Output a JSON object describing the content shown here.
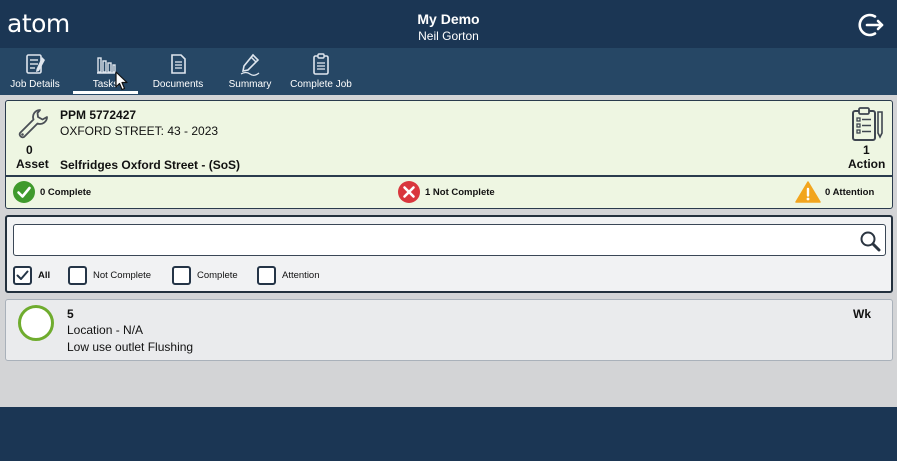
{
  "header": {
    "logo_text": "atom",
    "title": "My Demo",
    "subtitle": "Neil Gorton",
    "logout_icon": "logout-icon"
  },
  "tabs": [
    {
      "label": "Job Details",
      "icon": "job-details-icon",
      "active": false
    },
    {
      "label": "Tasks",
      "icon": "tasks-icon",
      "active": true
    },
    {
      "label": "Documents",
      "icon": "documents-icon",
      "active": false
    },
    {
      "label": "Summary",
      "icon": "summary-icon",
      "active": false
    },
    {
      "label": "Complete Job",
      "icon": "complete-job-icon",
      "active": false
    }
  ],
  "job": {
    "ppm": "PPM 5772427",
    "street": "OXFORD STREET: 43 - 2023",
    "site": "Selfridges Oxford Street - (SoS)",
    "asset_count": "0",
    "asset_label": "Asset",
    "action_count": "1",
    "action_label": "Action",
    "stats": {
      "complete": "0 Complete",
      "not_complete": "1 Not Complete",
      "attention": "0 Attention"
    }
  },
  "filter": {
    "search_placeholder": "",
    "options": [
      {
        "label": "All",
        "checked": true
      },
      {
        "label": "Not Complete",
        "checked": false
      },
      {
        "label": "Complete",
        "checked": false
      },
      {
        "label": "Attention",
        "checked": false
      }
    ]
  },
  "tasks": [
    {
      "number": "5",
      "location": "Location - N/A",
      "description": "Low use outlet Flushing",
      "frequency": "Wk"
    }
  ],
  "colors": {
    "header_bg": "#1b3654",
    "tabbar_bg": "#264765",
    "job_panel_bg": "#eef6e2",
    "complete_green": "#3f9a2c",
    "not_complete_red": "#d9373d",
    "attention_amber": "#f2a51e",
    "ring_green": "#6fac2e"
  }
}
